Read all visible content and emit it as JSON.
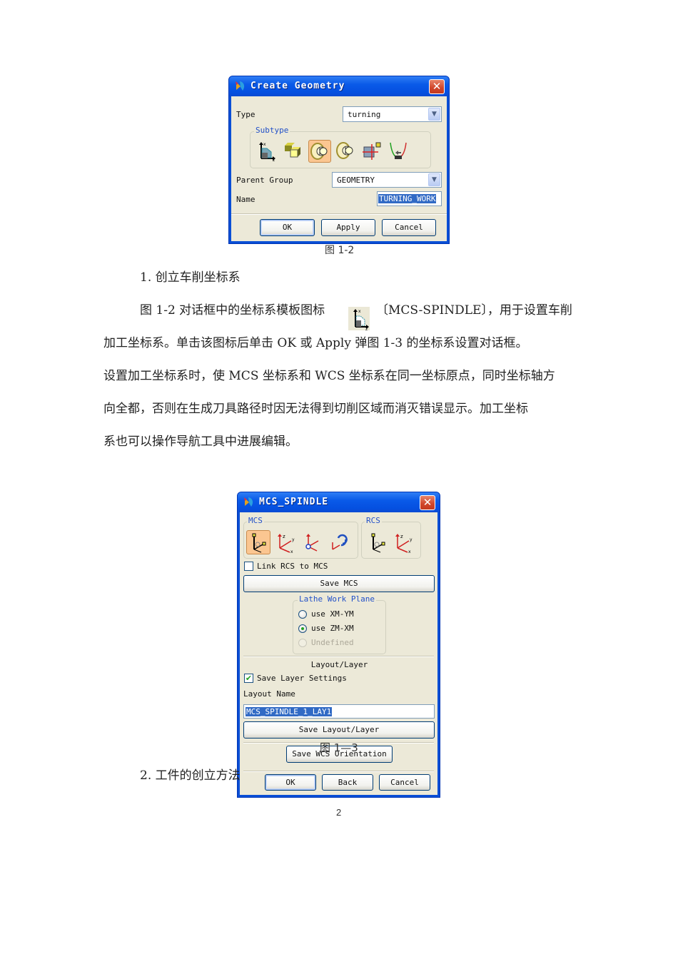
{
  "figure_1_2": {
    "dialog": {
      "title": "Create Geometry",
      "close_glyph": "✕",
      "type_label": "Type",
      "type_value": "turning",
      "subtype_label": "Subtype",
      "subtype_icons": [
        {
          "name": "mcs-spindle-icon",
          "selected": false
        },
        {
          "name": "workpiece-icon",
          "selected": false
        },
        {
          "name": "turning-workpiece-icon",
          "selected": true
        },
        {
          "name": "turning-part-icon",
          "selected": false
        },
        {
          "name": "avoidance-icon",
          "selected": false
        },
        {
          "name": "containment-icon",
          "selected": false
        }
      ],
      "parent_group_label": "Parent Group",
      "parent_group_value": "GEOMETRY",
      "name_label": "Name",
      "name_value": "TURNING_WORK",
      "ok_label": "OK",
      "apply_label": "Apply",
      "cancel_label": "Cancel"
    },
    "caption": "图 1-2"
  },
  "section_1": {
    "heading": "1.  创立车削坐标系",
    "para_line1_a": "图 1-2 对话框中的坐标系模板图标",
    "para_line1_b": "〔MCS-SPINDLE〕，用于设置车削",
    "para_line2": "加工坐标系。单击该图标后单击 OK 或 Apply 弹图 1-3 的坐标系设置对话框。",
    "para_line3": "设置加工坐标系时，使 MCS 坐标系和 WCS 坐标系在同一坐标原点，同时坐标轴方",
    "para_line4": "向全都，否则在生成刀具路径时因无法得到切削区域而消灭错误显示。加工坐标",
    "para_line5": "系也可以操作导航工具中进展编辑。"
  },
  "figure_1_3": {
    "dialog": {
      "title": "MCS_SPINDLE",
      "close_glyph": "✕",
      "mcs_group_label": "MCS",
      "rcs_group_label": "RCS",
      "mcs_icons": [
        {
          "name": "csys-dialog-icon",
          "selected": true
        },
        {
          "name": "wcs-csys-icon",
          "selected": false
        },
        {
          "name": "origin-csys-icon",
          "selected": false
        },
        {
          "name": "rotate-csys-icon",
          "selected": false
        }
      ],
      "rcs_icons": [
        {
          "name": "rcs-csys-dialog-icon",
          "selected": false
        },
        {
          "name": "rcs-wcs-csys-icon",
          "selected": false
        }
      ],
      "link_rcs_label": "Link RCS to MCS",
      "link_rcs_checked": false,
      "save_mcs_label": "Save MCS",
      "lathe_plane_label": "Lathe Work Plane",
      "lathe_options": [
        {
          "label": "use XM-YM",
          "checked": false,
          "disabled": false
        },
        {
          "label": "use ZM-XM",
          "checked": true,
          "disabled": false
        },
        {
          "label": "Undefined",
          "checked": false,
          "disabled": true
        }
      ],
      "layout_layer_heading": "Layout/Layer",
      "save_layer_label": "Save Layer Settings",
      "save_layer_checked": true,
      "check_glyph": "✔",
      "layout_name_label": "Layout Name",
      "layout_name_value": "MCS_SPINDLE_1_LAY1",
      "save_layout_label": "Save Layout/Layer",
      "save_wcs_label": "Save WCS Orientation",
      "ok_label": "OK",
      "back_label": "Back",
      "cancel_label": "Cancel"
    },
    "caption": "图 1—3"
  },
  "section_2": {
    "heading": "2.  工件的创立方法"
  },
  "page_number": "2",
  "colors": {
    "title_bar": "#0a5ae8",
    "dialog_face": "#ece9d8",
    "group_title": "#2250c8",
    "selected_icon_bg": "#fbc691",
    "selection_highlight": "#316ac5",
    "close_button": "#d0452a"
  }
}
